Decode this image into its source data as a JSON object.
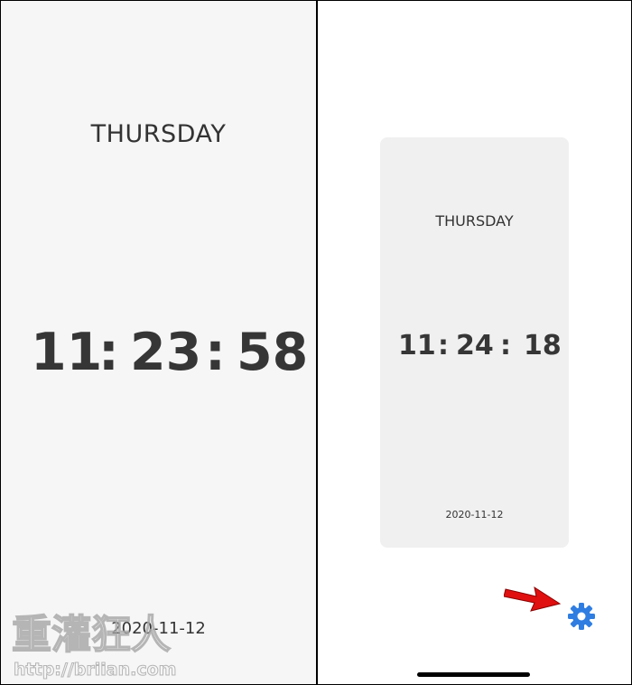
{
  "left": {
    "day": "THURSDAY",
    "hours": "11",
    "minutes": "23",
    "seconds": "58",
    "separator": ":",
    "date": "2020-11-12"
  },
  "preview": {
    "day": "THURSDAY",
    "hours": "11",
    "minutes": "24",
    "seconds": "18",
    "separator": ":",
    "date": "2020-11-12"
  },
  "controls": {
    "settings_icon": "gear-icon",
    "settings_color": "#2f7de1",
    "arrow_color": "#e01010"
  },
  "watermark": {
    "title": "重灌狂人",
    "url": "http://briian.com"
  }
}
